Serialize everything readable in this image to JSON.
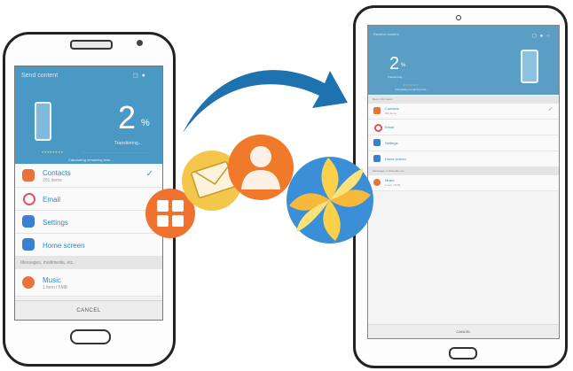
{
  "phone": {
    "title": "Send content",
    "progress_percent": 2,
    "percent_number": "2",
    "percent_sign": "%",
    "status": "Transferring...",
    "time_remaining": "Calculating remaining time...",
    "items": [
      {
        "label": "Contacts",
        "sub": "201 items",
        "icon": "contacts-icon",
        "color": "#e8743b",
        "checked": true
      },
      {
        "label": "Email",
        "sub": "",
        "icon": "email-icon",
        "color": "#e8505b",
        "checked": false
      },
      {
        "label": "Settings",
        "sub": "",
        "icon": "settings-icon",
        "color": "#3b7fd0",
        "checked": false
      },
      {
        "label": "Home screen",
        "sub": "",
        "icon": "home-screen-icon",
        "color": "#3b7fd0",
        "checked": false
      }
    ],
    "section": "Messages, multimedia, etc.",
    "extra_item": {
      "label": "Music",
      "sub": "1 item / 5MB",
      "icon": "music-icon",
      "color": "#e8743b"
    },
    "cancel": "CANCEL"
  },
  "tablet": {
    "title": "Receive content",
    "percent_number": "2",
    "percent_sign": "%",
    "status": "Transferring...",
    "time_remaining": "Calculating remaining time...",
    "section_top": "Basic information",
    "items": [
      {
        "label": "Contacts",
        "sub": "201 items",
        "icon": "contacts-icon",
        "color": "#e8743b",
        "checked": true
      },
      {
        "label": "Email",
        "sub": "",
        "icon": "email-icon",
        "color": "#e8505b",
        "checked": false
      },
      {
        "label": "Settings",
        "sub": "",
        "icon": "settings-icon",
        "color": "#3b7fd0",
        "checked": false
      },
      {
        "label": "Home screen",
        "sub": "",
        "icon": "home-screen-icon",
        "color": "#3b7fd0",
        "checked": false
      }
    ],
    "section": "Messages, multimedia, etc.",
    "extra_item": {
      "label": "Music",
      "sub": "1 item / 5MB"
    },
    "cancel": "CANCEL"
  },
  "colors": {
    "hero_blue": "#4a98c4",
    "arrow_blue": "#1e72b0",
    "accent_orange": "#e8743b",
    "accent_yellow": "#f3c94a"
  },
  "floating_icons": [
    "apps-grid-icon",
    "envelope-icon",
    "contact-person-icon",
    "gallery-pinwheel-icon"
  ]
}
